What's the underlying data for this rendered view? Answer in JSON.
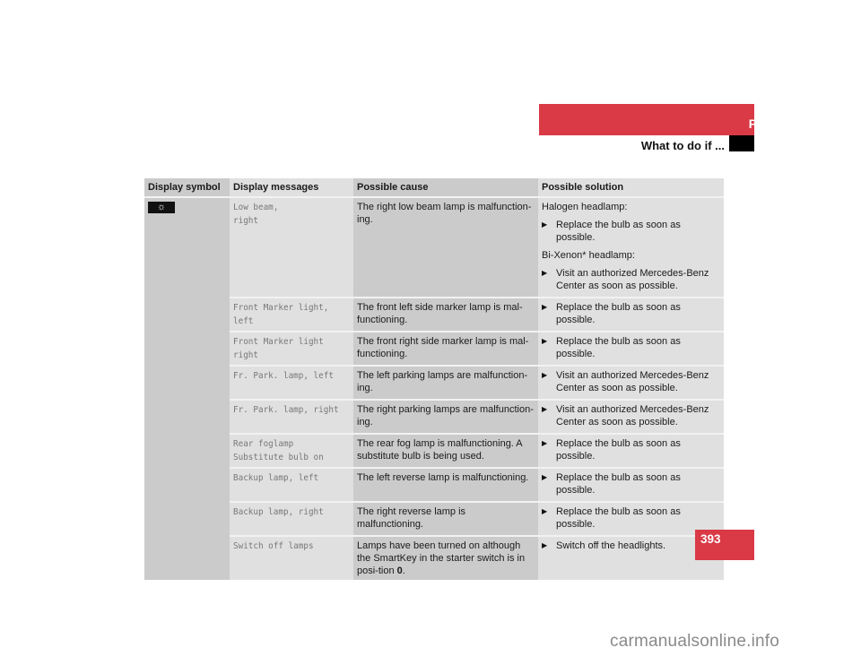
{
  "header": {
    "section": "Practical hints",
    "subsection": "What to do if ..."
  },
  "page_number": "393",
  "watermark": "carmanualsonline.info",
  "table": {
    "columns": [
      "Display symbol",
      "Display messages",
      "Possible cause",
      "Possible solution"
    ],
    "symbol_icon": "low-beam-lamp-icon",
    "symbol_glyph": "☼",
    "rows": [
      {
        "message": [
          "Low beam,",
          "right"
        ],
        "cause": "The right low beam lamp is malfunction-ing.",
        "solution": [
          {
            "type": "text",
            "text": "Halogen headlamp:"
          },
          {
            "type": "step",
            "text": "Replace the bulb as soon as possible."
          },
          {
            "type": "text",
            "text": "Bi-Xenon* headlamp:"
          },
          {
            "type": "step",
            "text": "Visit an authorized Mercedes-Benz Center as soon as possible."
          }
        ]
      },
      {
        "message": [
          "Front Marker light,",
          "left"
        ],
        "cause": "The front left side marker lamp is mal-functioning.",
        "solution": [
          {
            "type": "step",
            "text": "Replace the bulb as soon as possible."
          }
        ]
      },
      {
        "message": [
          "Front Marker light",
          "right"
        ],
        "cause": "The front right side marker lamp is mal-functioning.",
        "solution": [
          {
            "type": "step",
            "text": "Replace the bulb as soon as possible."
          }
        ]
      },
      {
        "message": [
          "Fr. Park. lamp, left"
        ],
        "cause": "The left parking lamps are malfunction-ing.",
        "solution": [
          {
            "type": "step",
            "text": "Visit an authorized Mercedes-Benz Center as soon as possible."
          }
        ]
      },
      {
        "message": [
          "Fr. Park. lamp, right"
        ],
        "cause": "The right parking lamps are malfunction-ing.",
        "solution": [
          {
            "type": "step",
            "text": "Visit an authorized Mercedes-Benz Center as soon as possible."
          }
        ]
      },
      {
        "message": [
          "Rear foglamp",
          "Substitute bulb on"
        ],
        "cause": "The rear fog lamp is malfunctioning. A substitute bulb is being used.",
        "solution": [
          {
            "type": "step",
            "text": "Replace the bulb as soon as possible."
          }
        ]
      },
      {
        "message": [
          "Backup lamp, left"
        ],
        "cause": "The left reverse lamp is malfunctioning.",
        "solution": [
          {
            "type": "step",
            "text": "Replace the bulb as soon as possible."
          }
        ]
      },
      {
        "message": [
          "Backup lamp, right"
        ],
        "cause": "The right reverse lamp is malfunctioning.",
        "solution": [
          {
            "type": "step",
            "text": "Replace the bulb as soon as possible."
          }
        ]
      },
      {
        "message": [
          "Switch off lamps"
        ],
        "cause": "Lamps have been turned on although the SmartKey in the starter switch is in posi-tion",
        "cause_bold_suffix": "0",
        "cause_end": ".",
        "solution": [
          {
            "type": "step",
            "text": "Switch off the headlights."
          }
        ]
      }
    ]
  },
  "colors": {
    "brand_red": "#d93a46",
    "cell_dark": "#cbcbcb",
    "cell_light": "#e0e0e0"
  }
}
